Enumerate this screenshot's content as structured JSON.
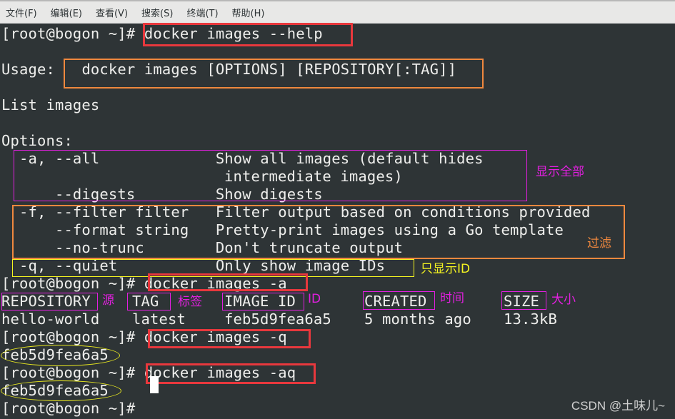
{
  "menu": {
    "items": [
      {
        "label": "文件(F)"
      },
      {
        "label": "编辑(E)"
      },
      {
        "label": "查看(V)"
      },
      {
        "label": "搜索(S)"
      },
      {
        "label": "终端(T)"
      },
      {
        "label": "帮助(H)"
      }
    ]
  },
  "terminal": {
    "prompt": "[root@bogon ~]#",
    "lines": {
      "cmd_help": "docker images --help",
      "usage_label": "Usage:",
      "usage_syntax": "docker images [OPTIONS] [REPOSITORY[:TAG]]",
      "list_images": "List images",
      "options_header": "Options:",
      "opt_all": "  -a, --all             ",
      "opt_all_desc": "Show all images (default hides",
      "opt_all_desc2": "intermediate images)",
      "opt_digests": "      --digests         ",
      "opt_digests_desc": "Show digests",
      "opt_filter": "  -f, --filter filter   ",
      "opt_filter_desc": "Filter output based on conditions provided",
      "opt_format": "      --format string   ",
      "opt_format_desc": "Pretty-print images using a Go template",
      "opt_notrunc": "      --no-trunc        ",
      "opt_notrunc_desc": "Don't truncate output",
      "opt_quiet": "  -q, --quiet           ",
      "opt_quiet_desc": "Only show image IDs",
      "cmd_a": "docker images -a",
      "cmd_q": "docker images -q",
      "cmd_aq": "docker images -aq",
      "q_output": "feb5d9fea6a5",
      "aq_output": "feb5d9fea6a5"
    },
    "table": {
      "headers": [
        "REPOSITORY",
        "TAG",
        "IMAGE ID",
        "CREATED",
        "SIZE"
      ],
      "rows": [
        [
          "hello-world",
          "latest",
          "feb5d9fea6a5",
          "5 months ago",
          "13.3kB"
        ]
      ]
    }
  },
  "annotations": {
    "show_all": "显示全部",
    "filter": "过滤",
    "only_id": "只显示ID",
    "repository": "源",
    "tag": "标签",
    "image_id": "ID",
    "created": "时间",
    "size": "大小"
  },
  "colors": {
    "terminal_bg": "#2e3436",
    "text": "#eeeeec",
    "red_box": "#e8383d",
    "orange_box": "#f0883e",
    "magenta_box": "#e31fe0",
    "yellow_box": "#f5f521"
  },
  "watermark": "CSDN @土味儿~"
}
